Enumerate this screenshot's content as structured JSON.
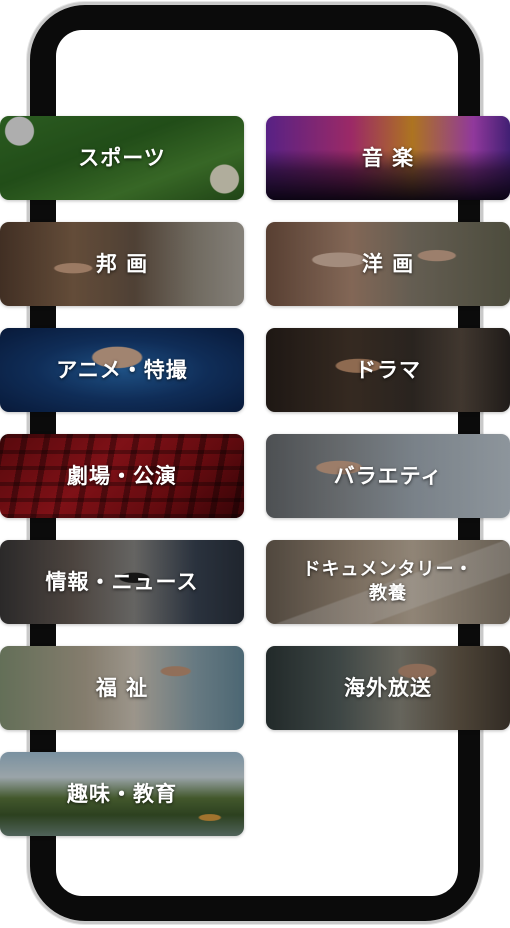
{
  "categories": {
    "sports": "スポーツ",
    "ongaku": "音 楽",
    "hogaku": "邦 画",
    "yoga": "洋 画",
    "anime": "アニメ・特撮",
    "drama": "ドラマ",
    "gekijo": "劇場・公演",
    "variety": "バラエティ",
    "joho": "情報・ニュース",
    "docu": "ドキュメンタリー・\n教養",
    "fukushi": "福 祉",
    "kaigai": "海外放送",
    "shumi": "趣味・教育"
  }
}
